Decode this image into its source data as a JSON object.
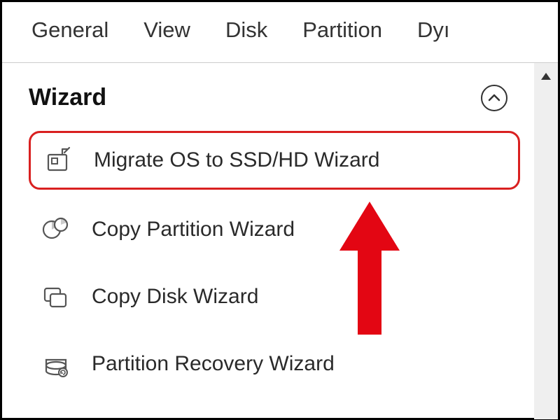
{
  "menu": {
    "items": [
      "General",
      "View",
      "Disk",
      "Partition",
      "Dyı"
    ]
  },
  "sidebar": {
    "section_title": "Wizard",
    "items": [
      {
        "label": "Migrate OS to SSD/HD Wizard"
      },
      {
        "label": "Copy Partition Wizard"
      },
      {
        "label": "Copy Disk Wizard"
      },
      {
        "label": "Partition Recovery Wizard"
      }
    ]
  }
}
